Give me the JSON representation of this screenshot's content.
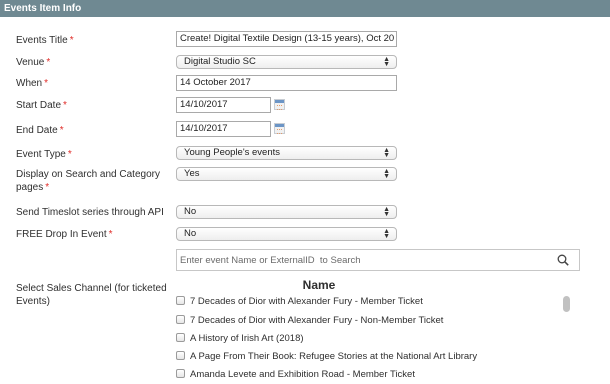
{
  "section": {
    "title": "Events Item Info"
  },
  "fields": {
    "events_title": {
      "label": "Events Title",
      "value": "Create! Digital Textile Design (13-15 years), Oct 20"
    },
    "venue": {
      "label": "Venue",
      "value": "Digital Studio SC"
    },
    "when": {
      "label": "When",
      "value": "14 October 2017"
    },
    "start_date": {
      "label": "Start Date",
      "value": "14/10/2017"
    },
    "end_date": {
      "label": "End Date",
      "value": "14/10/2017"
    },
    "event_type": {
      "label": "Event Type",
      "value": "Young People's events"
    },
    "display_on_search": {
      "label_line1": "Display on Search and Category",
      "label_line2": "pages",
      "value": "Yes"
    },
    "send_timeslot": {
      "label": "Send Timeslot series through API",
      "value": "No"
    },
    "free_drop_in": {
      "label": "FREE Drop In Event",
      "value": "No"
    }
  },
  "required_mark": "*",
  "search": {
    "placeholder": "Enter event Name or ExternalID  to Search"
  },
  "sales_channel": {
    "label_line1": "Select Sales Channel (for ticketed",
    "label_line2": "Events)",
    "column_header": "Name",
    "items": [
      "7 Decades of Dior with Alexander Fury - Member Ticket",
      "7 Decades of Dior with Alexander Fury - Non-Member Ticket",
      "A History of Irish Art (2018)",
      "A Page From Their Book: Refugee Stories at the National Art Library",
      "Amanda Levete and Exhibition Road - Member Ticket"
    ]
  },
  "colors": {
    "header_bg": "#6f8992",
    "required": "#e02b27"
  }
}
